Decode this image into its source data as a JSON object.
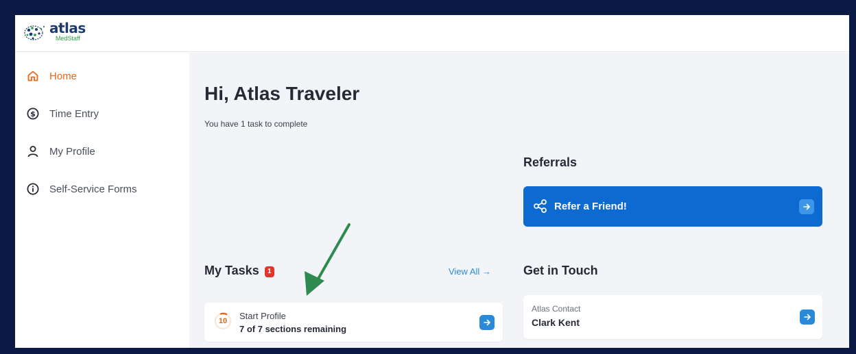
{
  "brand": {
    "name": "atlas",
    "sub": "MedStaff"
  },
  "sidebar": {
    "items": [
      {
        "label": "Home",
        "icon": "home-icon",
        "active": true
      },
      {
        "label": "Time Entry",
        "icon": "dollar-circle-icon",
        "active": false
      },
      {
        "label": "My Profile",
        "icon": "user-icon",
        "active": false
      },
      {
        "label": "Self-Service Forms",
        "icon": "info-circle-icon",
        "active": false
      }
    ]
  },
  "main": {
    "greeting": "Hi, Atlas Traveler",
    "task_count_text": "You have 1 task to complete"
  },
  "tasks": {
    "title": "My Tasks",
    "badge": "1",
    "view_all": "View All →",
    "items": [
      {
        "progress_number": "10",
        "title": "Start Profile",
        "subtitle": "7 of 7 sections remaining"
      }
    ]
  },
  "referrals": {
    "title": "Referrals",
    "button_label": "Refer a Friend!"
  },
  "contact": {
    "title": "Get in Touch",
    "label": "Atlas Contact",
    "name": "Clark Kent"
  },
  "colors": {
    "accent": "#e8651b",
    "primary_blue": "#0d6ad1",
    "link_blue": "#2b8ad8",
    "badge_red": "#e0352b",
    "frame_navy": "#0a1a44",
    "annotation_green": "#2f8a4f"
  }
}
